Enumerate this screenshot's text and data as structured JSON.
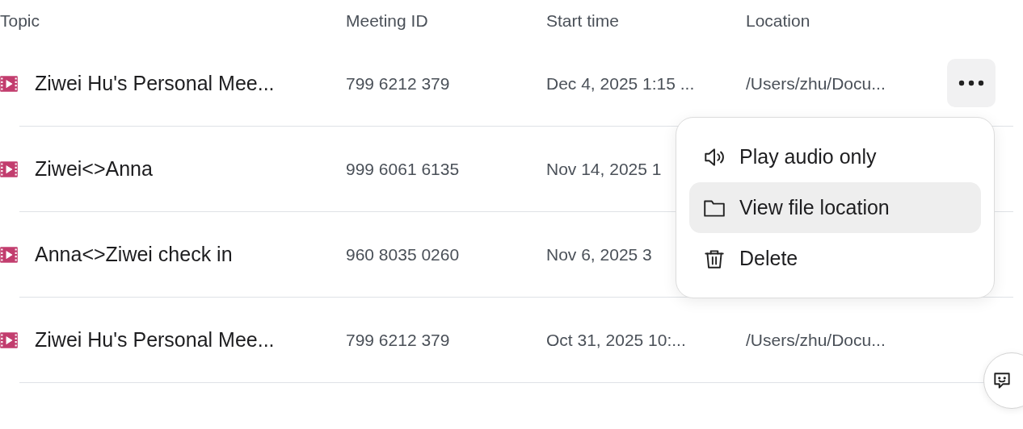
{
  "table": {
    "columns": [
      "Topic",
      "Meeting ID",
      "Start time",
      "Location"
    ],
    "rows": [
      {
        "topic": "Ziwei Hu's Personal Mee...",
        "meeting_id": "799 6212 379",
        "start_time": "Dec 4, 2025 1:15 ...",
        "location": "/Users/zhu/Docu..."
      },
      {
        "topic": "Ziwei<>Anna",
        "meeting_id": "999 6061 6135",
        "start_time": "Nov 14, 2025 1"
      },
      {
        "topic": "Anna<>Ziwei check in",
        "meeting_id": "960 8035 0260",
        "start_time": "Nov 6, 2025 3"
      },
      {
        "topic": "Ziwei Hu's Personal Mee...",
        "meeting_id": "799 6212 379",
        "start_time": "Oct 31, 2025 10:...",
        "location": "/Users/zhu/Docu..."
      }
    ]
  },
  "context_menu": {
    "items": [
      {
        "kind": "audio",
        "label": "Play audio only",
        "selected": false
      },
      {
        "kind": "folder",
        "label": "View file location",
        "selected": true
      },
      {
        "kind": "trash",
        "label": "Delete",
        "selected": false
      }
    ]
  }
}
